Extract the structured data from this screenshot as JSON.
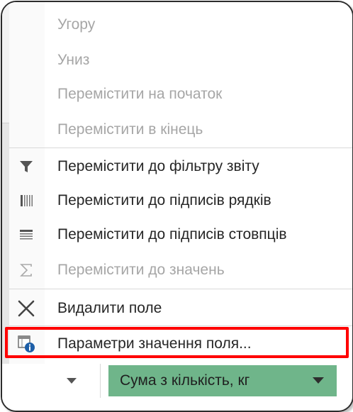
{
  "menu": {
    "items": [
      {
        "label": "Угору",
        "enabled": false,
        "icon": ""
      },
      {
        "label": "Униз",
        "enabled": false,
        "icon": ""
      },
      {
        "label": "Перемістити на початок",
        "enabled": false,
        "icon": ""
      },
      {
        "label": "Перемістити в кінець",
        "enabled": false,
        "icon": ""
      },
      {
        "label": "Перемістити до фільтру звіту",
        "enabled": true,
        "icon": "filter-icon"
      },
      {
        "label": "Перемістити до підписів рядків",
        "enabled": true,
        "icon": "row-labels-icon"
      },
      {
        "label": "Перемістити до підписів стовпців",
        "enabled": true,
        "icon": "column-labels-icon"
      },
      {
        "label": "Перемістити до значень",
        "enabled": false,
        "icon": "sigma-icon"
      },
      {
        "label": "Видалити поле",
        "enabled": true,
        "icon": "delete-x-icon"
      },
      {
        "label": "Параметри значення поля...",
        "enabled": true,
        "icon": "field-settings-icon",
        "highlighted": true
      }
    ]
  },
  "field_area": {
    "value_field_label": "Сума з кількість, кг",
    "chip_color": "#6fb58a"
  },
  "colors": {
    "highlight": "#ff0000",
    "disabled_text": "#a6a6a6",
    "text": "#262626"
  }
}
